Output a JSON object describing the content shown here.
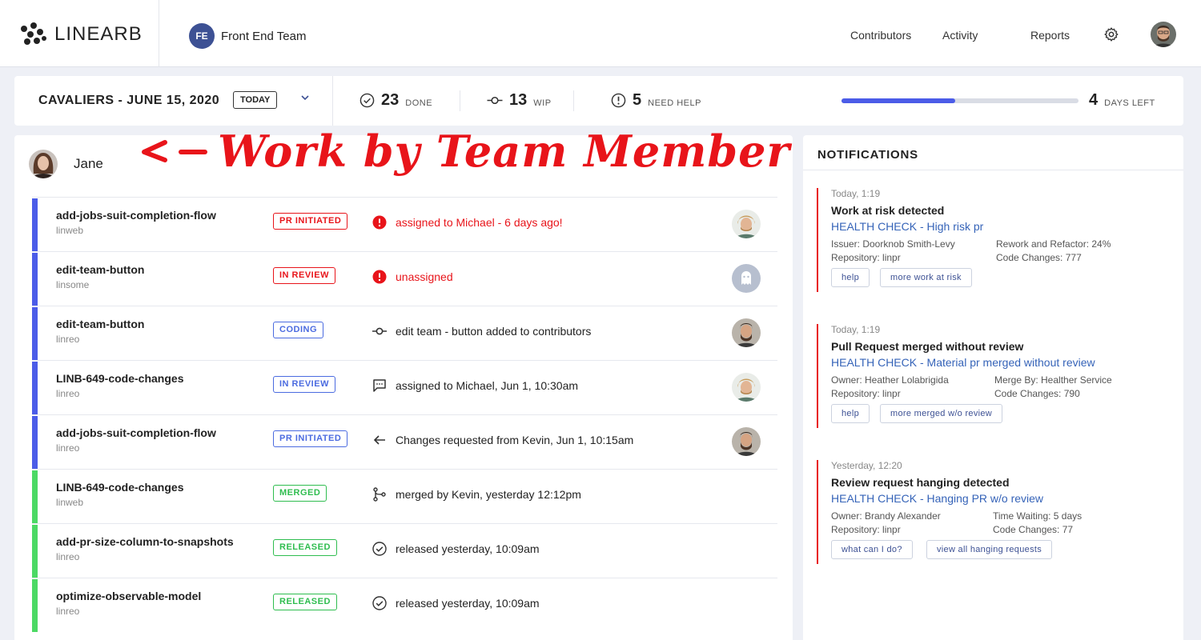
{
  "nav": {
    "logo": "LINEARB",
    "team_initials": "FE",
    "team_name": "Front End Team",
    "links": [
      "Contributors",
      "Activity",
      "Reports"
    ]
  },
  "sprint": {
    "title": "CAVALIERS - JUNE 15, 2020",
    "today_label": "TODAY",
    "done_count": "23",
    "done_label": "DONE",
    "wip_count": "13",
    "wip_label": "WIP",
    "help_count": "5",
    "help_label": "NEED HELP",
    "progress": 0.48,
    "days_left": "4",
    "days_label": "DAYS LEFT"
  },
  "member": {
    "name": "Jane",
    "annotation": "Work by Team Member"
  },
  "colors": {
    "blue_bar": "#4b5ce8",
    "green_bar": "#4cd964",
    "red": "#e8141a",
    "blue_badge": "#4b6be0",
    "green_badge": "#2fbd4f",
    "link": "#3563b8"
  },
  "rows": [
    {
      "name": "add-jobs-suit-completion-flow",
      "repo": "linweb",
      "status": "PR INITIATED",
      "tone": "red",
      "bar": "blue",
      "icon": "alert-icon",
      "text": "assigned to Michael - 6 days ago!",
      "text_tone": "red",
      "avatar": "blonde"
    },
    {
      "name": "edit-team-button",
      "repo": "linsome",
      "status": "IN REVIEW",
      "tone": "red",
      "bar": "blue",
      "icon": "alert-icon",
      "text": "unassigned",
      "text_tone": "red",
      "avatar": "ghost"
    },
    {
      "name": "edit-team-button",
      "repo": "linreo",
      "status": "CODING",
      "tone": "blue",
      "bar": "blue",
      "icon": "commit-icon",
      "text": "edit team - button added to contributors",
      "text_tone": "dark",
      "avatar": "beard"
    },
    {
      "name": "LINB-649-code-changes",
      "repo": "linreo",
      "status": "IN REVIEW",
      "tone": "blue",
      "bar": "blue",
      "icon": "comment-icon",
      "text": "assigned to Michael,  Jun 1, 10:30am",
      "text_tone": "dark",
      "avatar": "blonde"
    },
    {
      "name": "add-jobs-suit-completion-flow",
      "repo": "linreo",
      "status": "PR INITIATED",
      "tone": "blue",
      "bar": "blue",
      "icon": "arrow-left-icon",
      "text": "Changes requested from Kevin, Jun 1, 10:15am",
      "text_tone": "dark",
      "avatar": "beard"
    },
    {
      "name": "LINB-649-code-changes",
      "repo": "linweb",
      "status": "MERGED",
      "tone": "green",
      "bar": "green",
      "icon": "merge-icon",
      "text": "merged by Kevin, yesterday 12:12pm",
      "text_tone": "dark",
      "avatar": ""
    },
    {
      "name": "add-pr-size-column-to-snapshots",
      "repo": "linreo",
      "status": "RELEASED",
      "tone": "green",
      "bar": "green",
      "icon": "check-circle-icon",
      "text": "released yesterday, 10:09am",
      "text_tone": "dark",
      "avatar": ""
    },
    {
      "name": "optimize-observable-model",
      "repo": "linreo",
      "status": "RELEASED",
      "tone": "green",
      "bar": "green",
      "icon": "check-circle-icon",
      "text": "released yesterday, 10:09am",
      "text_tone": "dark",
      "avatar": ""
    }
  ],
  "notifications": {
    "title": "NOTIFICATIONS",
    "items": [
      {
        "time": "Today, 1:19",
        "heading": "Work at risk detected",
        "link": "HEALTH CHECK - High risk pr",
        "meta_left": [
          "Issuer: Doorknob Smith-Levy",
          "Repository: linpr"
        ],
        "meta_right": [
          "Rework and Refactor: 24%",
          "Code Changes: 777"
        ],
        "buttons": [
          "help",
          "more work at risk"
        ]
      },
      {
        "time": "Today, 1:19",
        "heading": "Pull Request merged without review",
        "link": "HEALTH CHECK - Material pr merged without review",
        "meta_left": [
          "Owner: Heather Lolabrigida",
          "Repository: linpr"
        ],
        "meta_right": [
          "Merge By: Healther Service",
          "Code Changes: 790"
        ],
        "buttons": [
          "help",
          "more merged w/o review"
        ]
      },
      {
        "time": "Yesterday, 12:20",
        "heading": "Review request hanging detected",
        "link": "HEALTH CHECK - Hanging PR w/o review",
        "meta_left": [
          "Owner: Brandy Alexander",
          "Repository: linpr"
        ],
        "meta_right": [
          "Time Waiting: 5 days",
          "Code Changes: 77"
        ],
        "buttons": [
          "what can I do?",
          "view all hanging requests"
        ]
      }
    ]
  }
}
